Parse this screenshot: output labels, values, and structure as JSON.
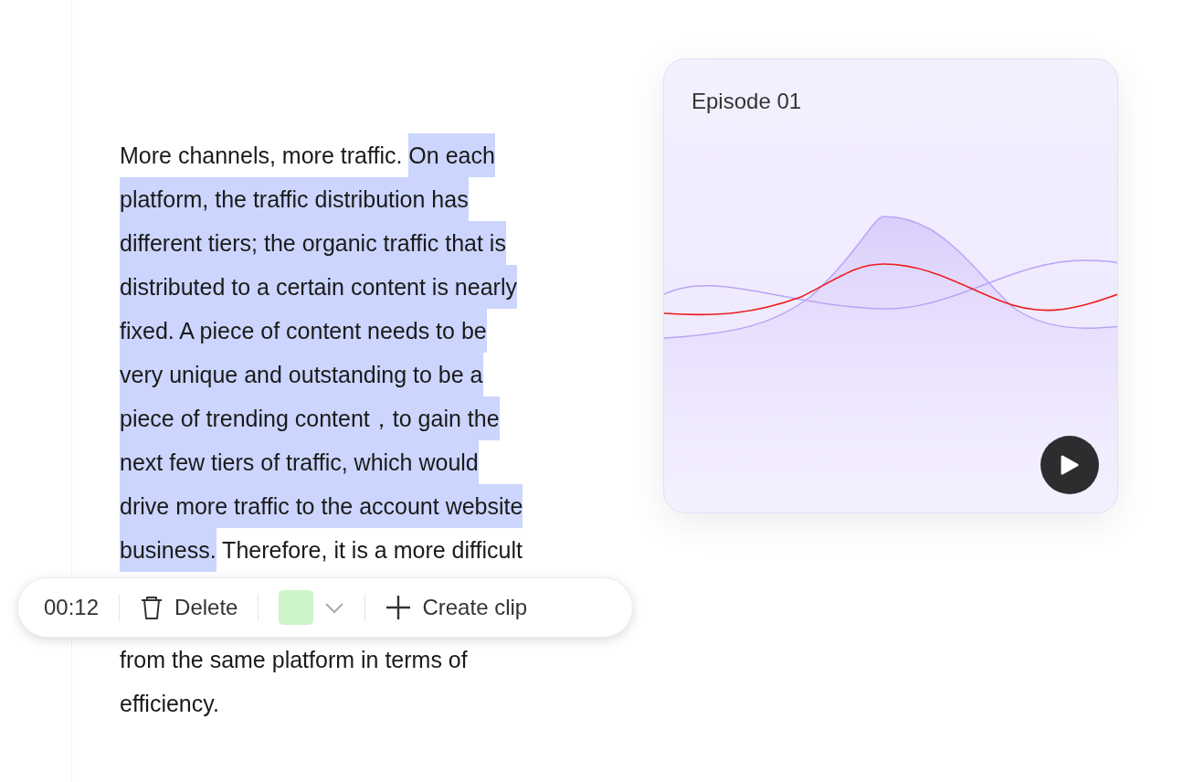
{
  "paragraph": {
    "lines": [
      {
        "segments": [
          {
            "text": "More channels, more traffic. ",
            "selected": false
          },
          {
            "text": "On each",
            "selected": true
          }
        ]
      },
      {
        "segments": [
          {
            "text": "platform, the traffic distribution has",
            "selected": true
          }
        ]
      },
      {
        "segments": [
          {
            "text": "different tiers; the organic traffic that is",
            "selected": true
          }
        ]
      },
      {
        "segments": [
          {
            "text": "distributed to a certain content is nearly",
            "selected": true
          }
        ]
      },
      {
        "segments": [
          {
            "text": "fixed. A piece of content needs to be",
            "selected": true
          }
        ]
      },
      {
        "segments": [
          {
            "text": "very unique and outstanding to be a",
            "selected": true
          }
        ]
      },
      {
        "segments": [
          {
            "text": "piece of trending content，to gain the",
            "selected": true
          }
        ]
      },
      {
        "segments": [
          {
            "text": "next few tiers of traffic, which would",
            "selected": true
          }
        ]
      },
      {
        "segments": [
          {
            "text": "drive more traffic to the account website",
            "selected": true
          }
        ]
      },
      {
        "segments": [
          {
            "text": "business.",
            "selected": true
          },
          {
            "text": " Therefore, it is a more difficult",
            "selected": false
          }
        ]
      }
    ],
    "lines_after_toolbar": [
      "from the same platform in terms of",
      "efficiency."
    ]
  },
  "toolbar": {
    "time": "00:12",
    "actions": [
      {
        "kind": "delete",
        "label": "Delete"
      },
      {
        "kind": "color",
        "color": "#cdf5cb"
      },
      {
        "kind": "create",
        "label": "Create clip"
      }
    ]
  },
  "episode_card": {
    "title": "Episode 01"
  }
}
